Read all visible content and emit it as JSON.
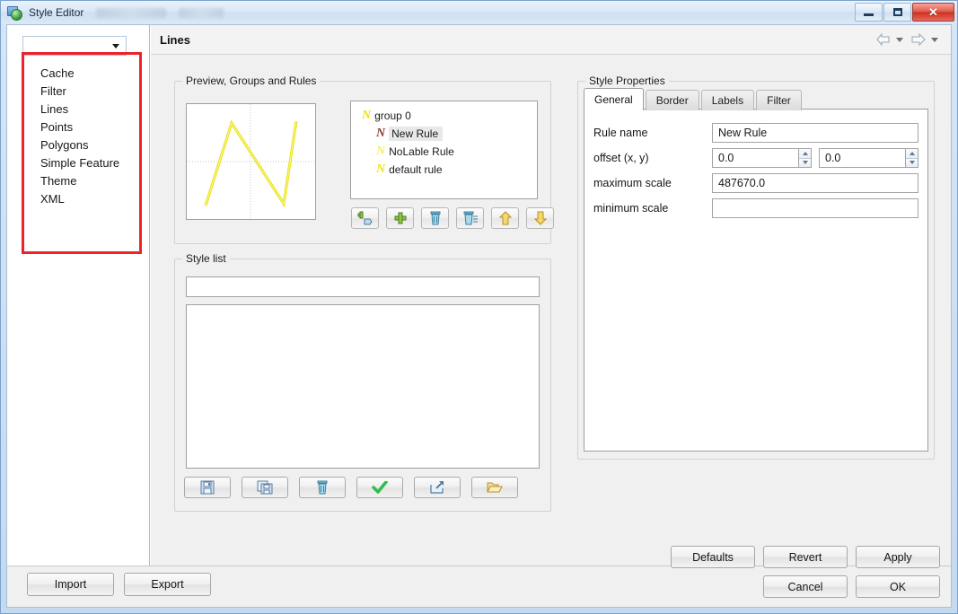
{
  "window": {
    "title": "Style Editor",
    "icon": "style-editor-icon",
    "controls": {
      "minimize": "minimize",
      "maximize": "maximize",
      "close": "close"
    }
  },
  "sidebar": {
    "combo": {
      "value": "",
      "placeholder": "",
      "icon": "chevron-down-icon"
    },
    "items": [
      {
        "label": "Cache"
      },
      {
        "label": "Filter"
      },
      {
        "label": "Lines"
      },
      {
        "label": "Points"
      },
      {
        "label": "Polygons"
      },
      {
        "label": "Simple Feature"
      },
      {
        "label": "Theme"
      },
      {
        "label": "XML"
      }
    ]
  },
  "header": {
    "title": "Lines",
    "nav": {
      "back_icon": "arrow-left-icon",
      "back_menu_icon": "chevron-down-icon",
      "forward_icon": "arrow-right-icon",
      "forward_menu_icon": "chevron-down-icon"
    }
  },
  "preview_groups_rules": {
    "title": "Preview, Groups and Rules",
    "preview": {
      "name": "preview-canvas",
      "shape": "N-polyline",
      "stroke_color": "#e8e10a"
    },
    "tree": [
      {
        "label": "group 0",
        "level": 0,
        "icon": "rule-n-icon",
        "icon_color": "#f2e01a",
        "selected": false
      },
      {
        "label": "New Rule",
        "level": 1,
        "icon": "rule-n-icon",
        "icon_color": "#8d3a32",
        "selected": true
      },
      {
        "label": "NoLable Rule",
        "level": 1,
        "icon": "rule-n-icon",
        "icon_color": "#f6ed6a",
        "selected": false
      },
      {
        "label": "default rule",
        "level": 1,
        "icon": "rule-n-icon",
        "icon_color": "#f2e01a",
        "selected": false
      }
    ],
    "toolbar": [
      {
        "name": "add-group-button",
        "icon": "add-group-icon"
      },
      {
        "name": "add-rule-button",
        "icon": "plus-icon"
      },
      {
        "name": "delete-rule-button",
        "icon": "trash-icon"
      },
      {
        "name": "delete-all-button",
        "icon": "trash-lines-icon"
      },
      {
        "name": "move-up-button",
        "icon": "arrow-up-icon"
      },
      {
        "name": "move-down-button",
        "icon": "arrow-down-icon"
      }
    ]
  },
  "style_list": {
    "title": "Style list",
    "name_input": {
      "value": "",
      "placeholder": ""
    },
    "items": [],
    "toolbar": [
      {
        "name": "save-style-button",
        "icon": "floppy-icon"
      },
      {
        "name": "save-as-style-button",
        "icon": "copy-floppy-icon"
      },
      {
        "name": "delete-style-button",
        "icon": "trash-icon"
      },
      {
        "name": "apply-style-button",
        "icon": "check-icon"
      },
      {
        "name": "export-style-button",
        "icon": "export-icon"
      },
      {
        "name": "open-style-button",
        "icon": "folder-open-icon"
      }
    ]
  },
  "style_properties": {
    "title": "Style Properties",
    "tabs": [
      {
        "label": "General",
        "active": true
      },
      {
        "label": "Border",
        "active": false
      },
      {
        "label": "Labels",
        "active": false
      },
      {
        "label": "Filter",
        "active": false
      }
    ],
    "fields": {
      "rule_name": {
        "label": "Rule name",
        "value": "New Rule"
      },
      "offset": {
        "label": "offset (x, y)",
        "x": "0.0",
        "y": "0.0"
      },
      "maximum_scale": {
        "label": "maximum scale",
        "value": "487670.0"
      },
      "minimum_scale": {
        "label": "minimum scale",
        "value": ""
      }
    }
  },
  "footer": {
    "import_label": "Import",
    "export_label": "Export",
    "defaults_label": "Defaults",
    "revert_label": "Revert",
    "apply_label": "Apply",
    "cancel_label": "Cancel",
    "ok_label": "OK"
  },
  "annotation": {
    "box_color": "#ef2229"
  }
}
